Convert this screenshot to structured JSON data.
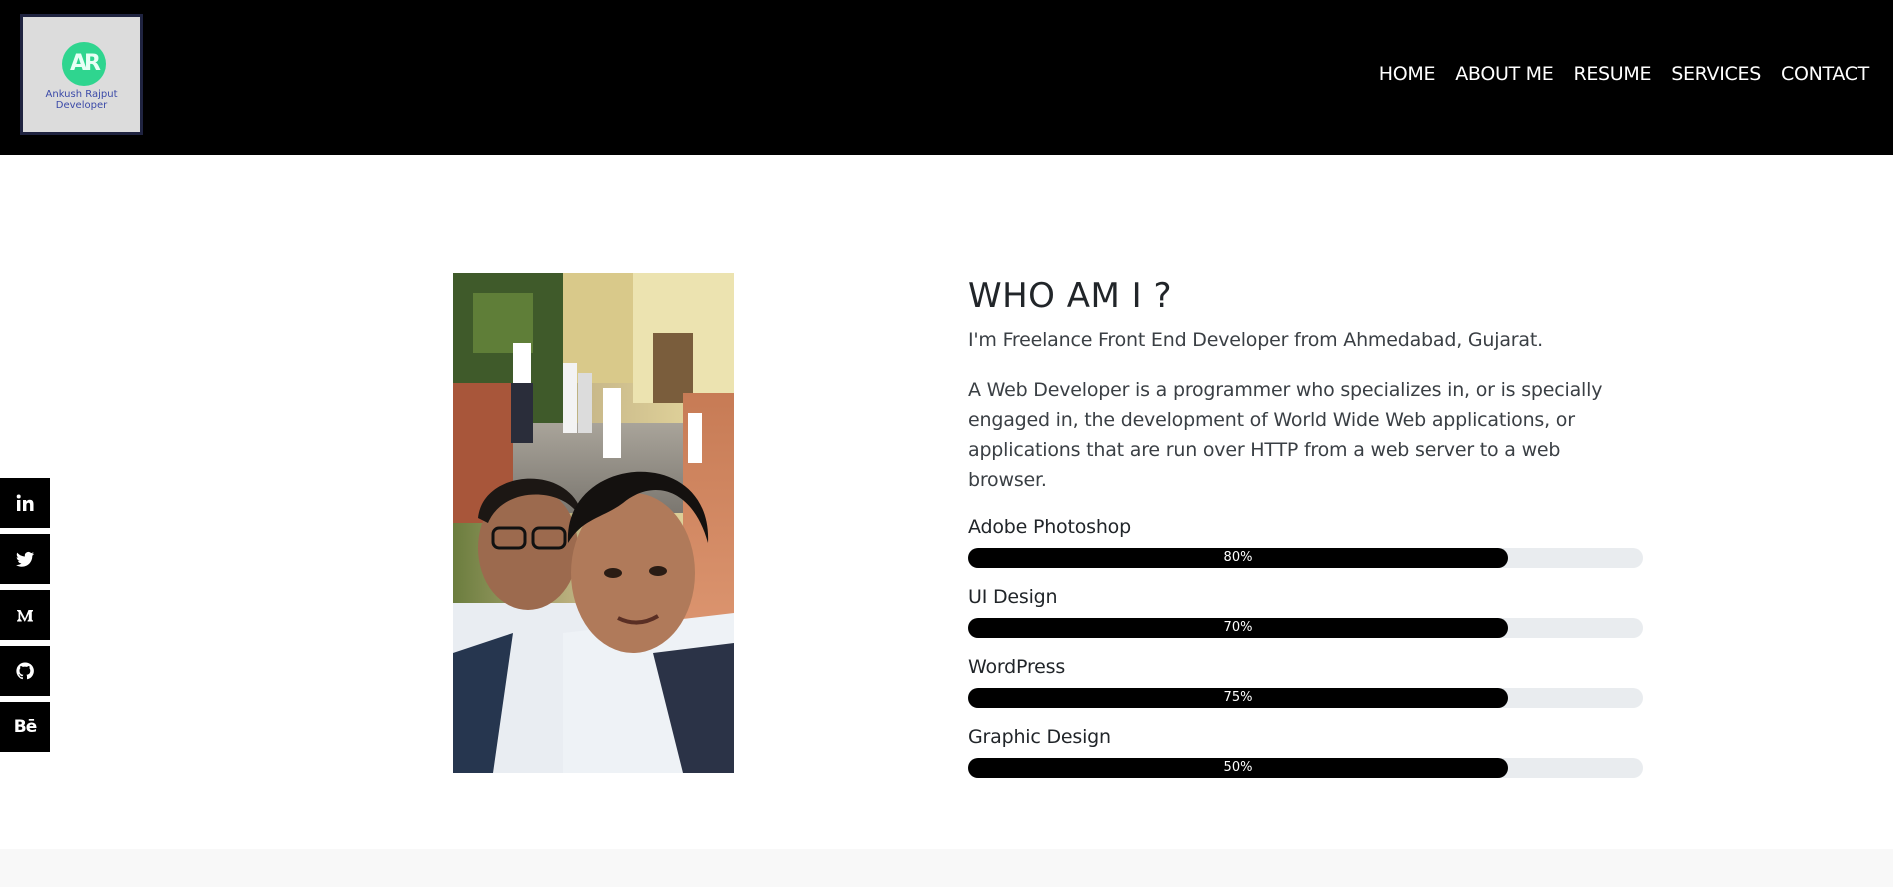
{
  "header": {
    "logo": {
      "monogram": "AR",
      "line1": "Ankush Rajput",
      "line2": "Developer"
    },
    "nav": [
      {
        "label": "HOME",
        "key": "home"
      },
      {
        "label": "ABOUT ME",
        "key": "about-me"
      },
      {
        "label": "RESUME",
        "key": "resume"
      },
      {
        "label": "SERVICES",
        "key": "services"
      },
      {
        "label": "CONTACT",
        "key": "contact"
      }
    ]
  },
  "social": [
    {
      "name": "linkedin-icon"
    },
    {
      "name": "twitter-icon"
    },
    {
      "name": "medium-icon"
    },
    {
      "name": "github-icon"
    },
    {
      "name": "behance-icon",
      "text": "Bē"
    }
  ],
  "about": {
    "heading": "WHO AM I ?",
    "intro": "I'm Freelance Front End Developer from Ahmedabad, Gujarat.",
    "description": "A Web Developer is a programmer who specializes in, or is specially engaged in, the development of World Wide Web applications, or applications that are run over HTTP from a web server to a web browser.",
    "skills": [
      {
        "name": "Adobe Photoshop",
        "percent_label": "80%",
        "fill": 0.8
      },
      {
        "name": "UI Design",
        "percent_label": "70%",
        "fill": 0.8
      },
      {
        "name": "WordPress",
        "percent_label": "75%",
        "fill": 0.8
      },
      {
        "name": "Graphic Design",
        "percent_label": "50%",
        "fill": 0.8
      }
    ]
  },
  "colors": {
    "header_bg": "#000000",
    "logo_accent": "#2fd58f",
    "bar_fill": "#000000",
    "bar_track": "#e9ecef"
  }
}
